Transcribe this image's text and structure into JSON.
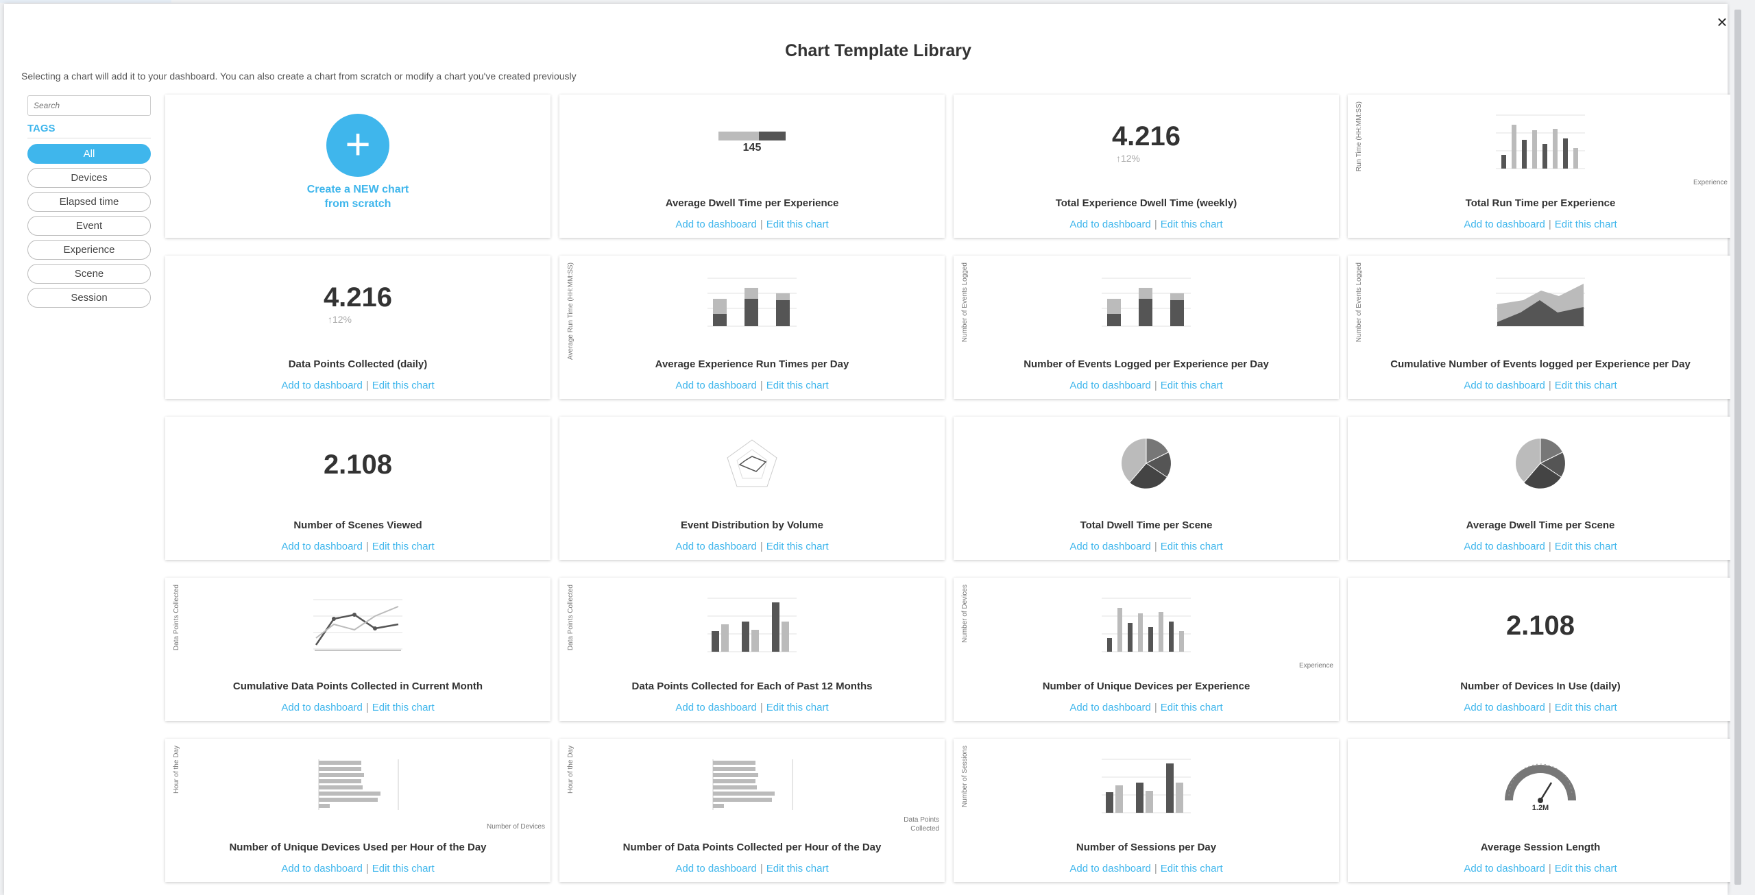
{
  "modal": {
    "title": "Chart Template Library",
    "subtitle": "Selecting a chart will add it to your dashboard. You can also create a chart from scratch or modify a chart you've created previously",
    "close_icon": "×"
  },
  "sidebar": {
    "search_placeholder": "Search",
    "tags_label": "TAGS",
    "tags": [
      "All",
      "Devices",
      "Elapsed time",
      "Event",
      "Experience",
      "Scene",
      "Session"
    ],
    "active_tag": "All"
  },
  "actions": {
    "add": "Add to dashboard",
    "edit": "Edit this chart",
    "separator": "|"
  },
  "new_chart": {
    "plus": "+",
    "line1": "Create a NEW chart",
    "line2": "from scratch"
  },
  "colors": {
    "accent": "#3fb6ec",
    "dark_bar": "#555555",
    "light_bar": "#bbbbbb"
  },
  "cards": [
    {
      "title": "Average Dwell Time per Experience",
      "preview": "stacked-bar-number",
      "value": "145"
    },
    {
      "title": "Total Experience Dwell Time (weekly)",
      "preview": "number-delta",
      "value": "4.216",
      "delta": "12%",
      "delta_icon": "arrow-up-icon"
    },
    {
      "title": "Total Run Time per Experience",
      "preview": "bars-varied",
      "ylabel": "Run Time (HH:MM:SS)",
      "xlabel": "Experience"
    },
    {
      "title": "Data Points Collected (daily)",
      "preview": "number-delta",
      "value": "4.216",
      "delta": "12%",
      "delta_icon": "arrow-up-icon"
    },
    {
      "title": "Average Experience Run Times per Day",
      "preview": "stacked-bars",
      "ylabel": "Average Run Time (HH:MM:SS)"
    },
    {
      "title": "Number of Events Logged per Experience per Day",
      "preview": "stacked-bars",
      "ylabel": "Number of Events Logged"
    },
    {
      "title": "Cumulative Number of Events logged per Experience per Day",
      "preview": "area",
      "ylabel": "Number of Events Logged"
    },
    {
      "title": "Number of Scenes Viewed",
      "preview": "number",
      "value": "2.108"
    },
    {
      "title": "Event Distribution by Volume",
      "preview": "radar"
    },
    {
      "title": "Total Dwell Time per Scene",
      "preview": "pie"
    },
    {
      "title": "Average Dwell Time per Scene",
      "preview": "pie"
    },
    {
      "title": "Cumulative Data Points Collected in Current Month",
      "preview": "line",
      "ylabel": "Data Points Collected"
    },
    {
      "title": "Data Points Collected for Each of Past 12 Months",
      "preview": "grouped-bars",
      "ylabel": "Data Points Collected"
    },
    {
      "title": "Number of Unique Devices per Experience",
      "preview": "bars-varied",
      "ylabel": "Number of Devices",
      "xlabel": "Experience"
    },
    {
      "title": "Number of Devices In Use (daily)",
      "preview": "number",
      "value": "2.108"
    },
    {
      "title": "Number of Unique Devices Used per Hour of the Day",
      "preview": "hbars",
      "ylabel": "Hour of the Day",
      "xlabel": "Number of Devices"
    },
    {
      "title": "Number of Data Points Collected per Hour of the Day",
      "preview": "hbars",
      "ylabel": "Hour of the Day",
      "xlabel": "Data Points Collected"
    },
    {
      "title": "Number of Sessions per Day",
      "preview": "grouped-bars",
      "ylabel": "Number of Sessions"
    },
    {
      "title": "Average Session Length",
      "preview": "gauge",
      "value": "1.2M"
    }
  ]
}
